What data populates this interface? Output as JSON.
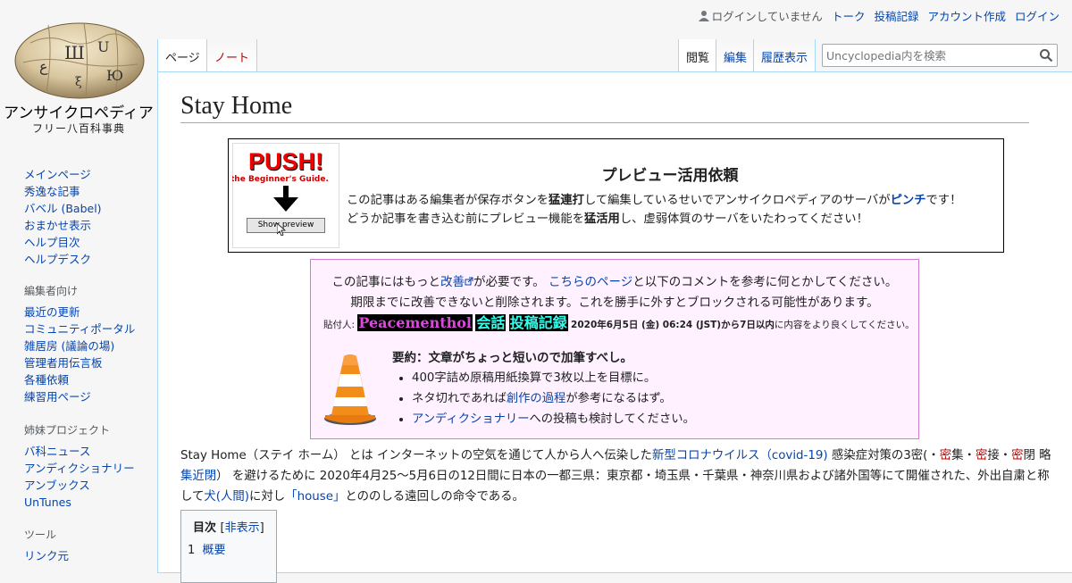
{
  "site": {
    "name": "アンサイクロペディア",
    "tagline": "フリー八百科事典"
  },
  "personal": {
    "not_logged_in": "ログインしていません",
    "talk": "トーク",
    "contributions": "投稿記録",
    "create_account": "アカウント作成",
    "login": "ログイン"
  },
  "tabs": {
    "page": "ページ",
    "note": "ノート",
    "view": "閲覧",
    "edit": "編集",
    "history": "履歴表示"
  },
  "search": {
    "placeholder": "Uncyclopedia内を検索"
  },
  "sidebar": {
    "navigation": [
      "メインページ",
      "秀逸な記事",
      "バベル (Babel)",
      "おまかせ表示",
      "ヘルプ目次",
      "ヘルプデスク"
    ],
    "editors_heading": "編集者向け",
    "editors": [
      "最近の更新",
      "コミュニティポータル",
      "雑居房 (議論の場)",
      "管理者用伝言板",
      "各種依頼",
      "練習用ページ"
    ],
    "sister_heading": "姉妹プロジェクト",
    "sister": [
      "バ科ニュース",
      "アンディクショナリー",
      "アンブックス",
      "UnTunes"
    ],
    "tools_heading": "ツール",
    "tools": [
      "リンク元"
    ]
  },
  "article": {
    "title": "Stay Home",
    "preview_notice": {
      "img_push": "PUSH!",
      "img_guide": "the Beginner's Guide.",
      "img_button": "Show preview",
      "title": "プレビュー活用依頼",
      "l1_a": "この記事はある編集者が保存ボタンを",
      "l1_b": "猛連打",
      "l1_c": "して編集しているせいでアンサイクロペディアのサーバが",
      "l1_d": "ピンチ",
      "l1_e": "です！",
      "l2_a": "どうか記事を書き込む前にプレビュー機能を",
      "l2_b": "猛活用",
      "l2_c": "し、虚弱体質のサーバをいたわってください！"
    },
    "improve_notice": {
      "l1_a": "この記事にはもっと",
      "l1_link": "改善",
      "l1_b": "が必要です。",
      "l1_link2": "こちらのページ",
      "l1_c": "と以下のコメントを参考に何とかしてください。",
      "line2": "期限までに改善できないと削除されます。これを勝手に外すとブロックされる可能性があります。",
      "poster_label": "貼付人:",
      "poster_name": "Peacementhol",
      "poster_talk": "会話",
      "poster_contribs": "投稿記録",
      "poster_date": "2020年6月5日 (金) 06:24 (JST)から7日以内",
      "poster_tail": "に内容をより良くしてください。",
      "summary_title": "要約：文章がちょっと短いので加筆すべし。",
      "bullet1": "400字詰め原稿用紙換算で3枚以上を目標に。",
      "bullet2_a": "ネタ切れであれば",
      "bullet2_link": "創作の過程",
      "bullet2_b": "が参考になるはず。",
      "bullet3_link": "アンディクショナリー",
      "bullet3_b": "への投稿も検討してください。"
    },
    "body": {
      "t1": "Stay Home（ステイ ホーム） とは インターネットの空気を通じて人から人へ伝染した",
      "link_covid": "新型コロナウイルス（covid-19)",
      "t2": " 感染症対策の3密(・",
      "mitsu1": "密",
      "t3": "集・",
      "mitsu2": "密",
      "t4": "接・",
      "mitsu3": "密",
      "t5": "閉 略 ",
      "link_kinheki": "集近閉",
      "t6": "） を避けるために 2020年4月25～5月6日の12日間に日本の一都三県：東京都・埼玉県・千葉県・神奈川県および諸外国等にて開催された、外出自粛と称して",
      "link_dog": "犬(人間)",
      "t7": "に対し",
      "link_house": "「house」",
      "t8": "とののしる遠回しの命令である。"
    },
    "toc": {
      "title": "目次",
      "toggle": "非表示",
      "item1_num": "1",
      "item1_label": "概要"
    }
  },
  "colors": {
    "link": "#0645ad",
    "redlink": "#ba0000",
    "notice_bg": "#fff1ff",
    "notice_border": "#d27bd2",
    "sig_name": "#d84ad8",
    "sig_cyan": "#33ffee"
  },
  "icons": [
    "wiki-globe-logo",
    "user-icon",
    "search-icon",
    "external-link-icon",
    "traffic-cone-icon",
    "down-arrow-icon",
    "mouse-cursor-icon"
  ]
}
